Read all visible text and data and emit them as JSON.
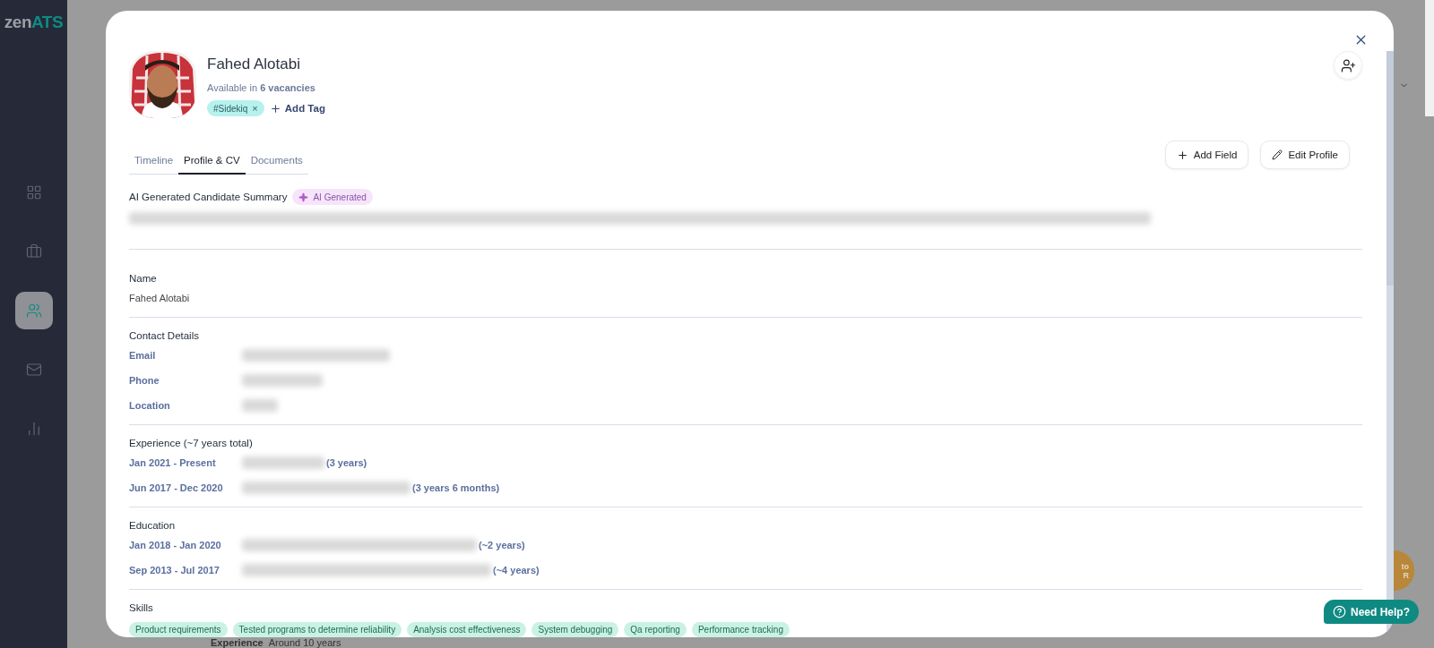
{
  "sidebar": {
    "logo": {
      "primary": "zen",
      "accent": "ATS"
    },
    "items": [
      {
        "kind": "grid",
        "selected": false
      },
      {
        "kind": "briefcase",
        "selected": false
      },
      {
        "kind": "people",
        "selected": true
      },
      {
        "kind": "mail",
        "selected": false
      },
      {
        "kind": "chart",
        "selected": false
      }
    ]
  },
  "background": {
    "field_label": "Experience",
    "field_value": "Around 10 years",
    "side_button": [
      "to",
      "R"
    ]
  },
  "candidate": {
    "name": "Fahed Alotabi",
    "availability": "Available in **6 vacancies**",
    "tags": [
      {
        "label": "#Sidekiq",
        "remove": "×"
      }
    ],
    "add_tag": "Add Tag"
  },
  "tabs": [
    {
      "label": "Timeline",
      "selected": false
    },
    {
      "label": "Profile & CV",
      "selected": true
    },
    {
      "label": "Documents",
      "selected": false
    }
  ],
  "actions": [
    {
      "kind": "add",
      "label": "Add Field"
    },
    {
      "kind": "edit",
      "label": "Edit Profile"
    }
  ],
  "summary": {
    "title": "AI Generated Candidate Summary",
    "badge": "AI Generated",
    "redacted": true
  },
  "sections": [
    {
      "kind": "field",
      "title": "Name",
      "value": "Fahed Alotabi"
    },
    {
      "kind": "details",
      "title": "Contact Details",
      "rows": [
        {
          "label": "Email",
          "redacted": true
        },
        {
          "label": "Phone",
          "redacted": true
        },
        {
          "label": "Location",
          "redacted": true
        }
      ]
    },
    {
      "kind": "timeline",
      "title": "Experience (~7 years total)",
      "rows": [
        {
          "period": "Jan 2021 - Present",
          "duration": "(3 years)",
          "redacted": true
        },
        {
          "period": "Jun 2017 - Dec 2020",
          "duration": "(3 years 6 months)",
          "redacted": true
        }
      ]
    },
    {
      "kind": "timeline",
      "title": "Education",
      "rows": [
        {
          "period": "Jan 2018 - Jan 2020",
          "duration": "(~2 years)",
          "redacted": true
        },
        {
          "period": "Sep 2013 - Jul 2017",
          "duration": "(~4 years)",
          "redacted": true
        }
      ]
    },
    {
      "kind": "chips",
      "title": "Skills",
      "chips": [
        "Product requirements",
        "Tested programs to determine reliability",
        "Analysis cost effectiveness",
        "System debugging",
        "Qa reporting",
        "Performance tracking"
      ]
    }
  ],
  "help": {
    "label": "Need Help?"
  }
}
